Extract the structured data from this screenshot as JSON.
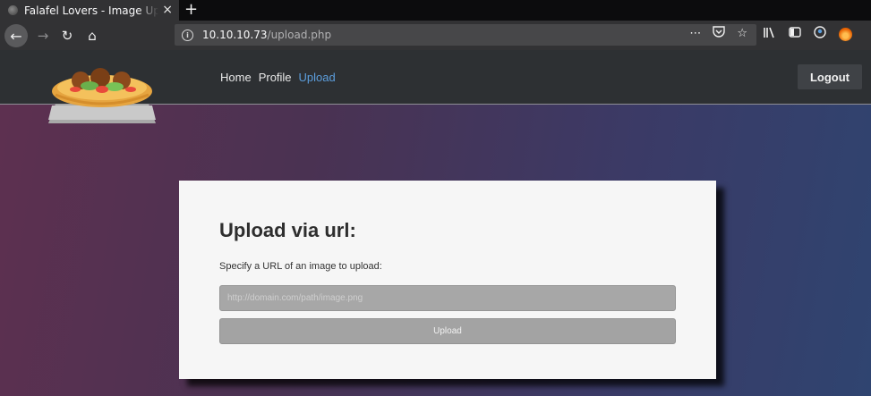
{
  "browser": {
    "tab": {
      "title": "Falafel Lovers - Image Upload",
      "close": "×"
    },
    "newtab_label": "+",
    "url": {
      "host": "10.10.10.73",
      "path": "/upload.php"
    },
    "icons": [
      "back-arrow-icon",
      "forward-arrow-icon",
      "reload-icon",
      "home-icon",
      "info-icon",
      "more-icon",
      "pocket-icon",
      "star-icon",
      "library-icon",
      "sidebar-icon",
      "account-icon",
      "firefox-icon"
    ]
  },
  "site": {
    "logo_text": "Falafel Lovers",
    "nav": {
      "home": "Home",
      "profile": "Profile",
      "upload": "Upload"
    },
    "active_nav": "upload",
    "logout": "Logout"
  },
  "upload": {
    "title": "Upload via url:",
    "description": "Specify a URL of an image to upload:",
    "input_placeholder": "http://domain.com/path/image.png",
    "input_value": "",
    "button": "Upload"
  },
  "colors": {
    "header_bg": "#2d3033",
    "active_link": "#5c9edd",
    "card_bg": "#f6f6f6",
    "button_bg": "#a3a3a3"
  }
}
